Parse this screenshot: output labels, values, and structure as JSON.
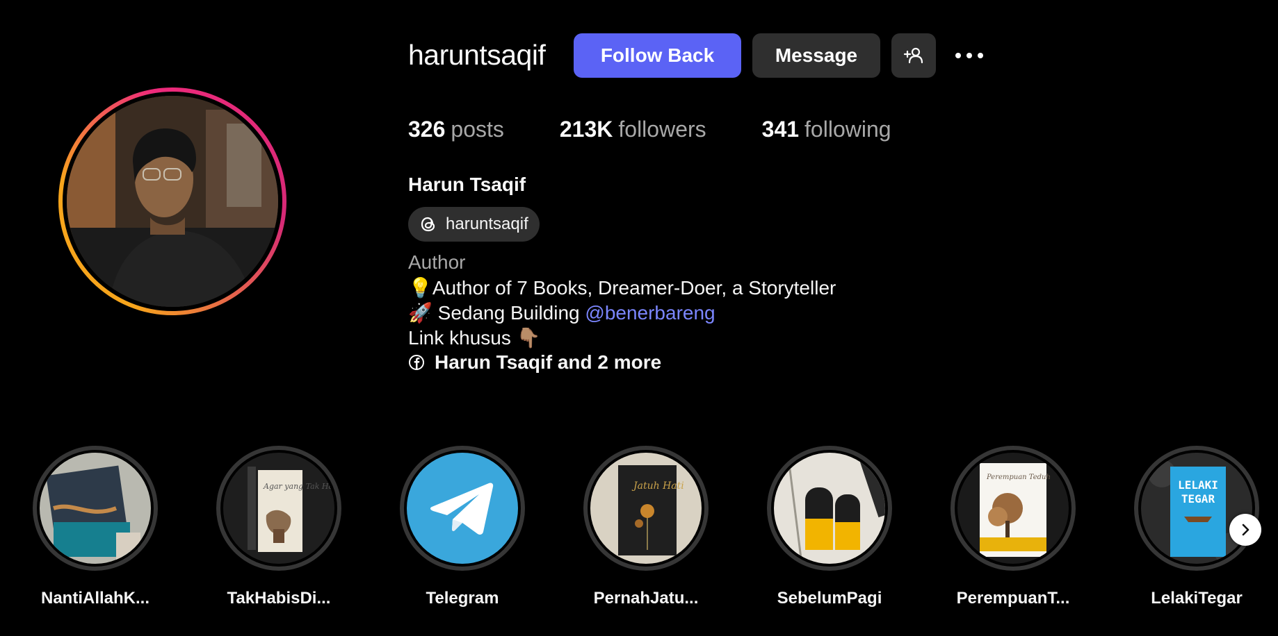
{
  "profile": {
    "username": "haruntsaqif",
    "full_name": "Harun Tsaqif",
    "threads_handle": "haruntsaqif",
    "category": "Author",
    "bio": {
      "line1_emoji": "💡",
      "line1_text": "Author of 7 Books, Dreamer-Doer, a Storyteller",
      "line2_emoji": "🚀",
      "line2_text": " Sedang Building ",
      "line2_mention": "@benerbareng",
      "line3_text": "Link khusus ",
      "line3_emoji": "👇🏽"
    },
    "links_text": "Harun Tsaqif and 2 more"
  },
  "actions": {
    "follow_back": "Follow Back",
    "message": "Message",
    "add_user_icon": "add-user-icon",
    "more_icon": "more-horizontal-icon"
  },
  "stats": {
    "posts_count": "326",
    "posts_label": "posts",
    "followers_count": "213K",
    "followers_label": "followers",
    "following_count": "341",
    "following_label": "following"
  },
  "colors": {
    "background": "#000000",
    "primary_button": "#5b63f5",
    "secondary_button": "#2f2f2f",
    "mention": "#7b86ff",
    "muted_text": "#a8a8a8",
    "story_ring_start": "#f7a51c",
    "story_ring_end": "#d62976",
    "telegram_blue": "#3aa7dc"
  },
  "highlights": [
    {
      "label": "NantiAllahK..."
    },
    {
      "label": "TakHabisDi..."
    },
    {
      "label": "Telegram"
    },
    {
      "label": "PernahJatu..."
    },
    {
      "label": "SebelumPagi"
    },
    {
      "label": "PerempuanT..."
    },
    {
      "label": "LelakiTegar"
    }
  ],
  "covers": {
    "takhabis_title": "Agar yang Tak Habis Dibaca",
    "jatuh_title": "Jatuh Hati",
    "perempuan_title": "Perempuan Teduh",
    "lelaki_title_1": "LELAKI",
    "lelaki_title_2": "TEGAR"
  }
}
